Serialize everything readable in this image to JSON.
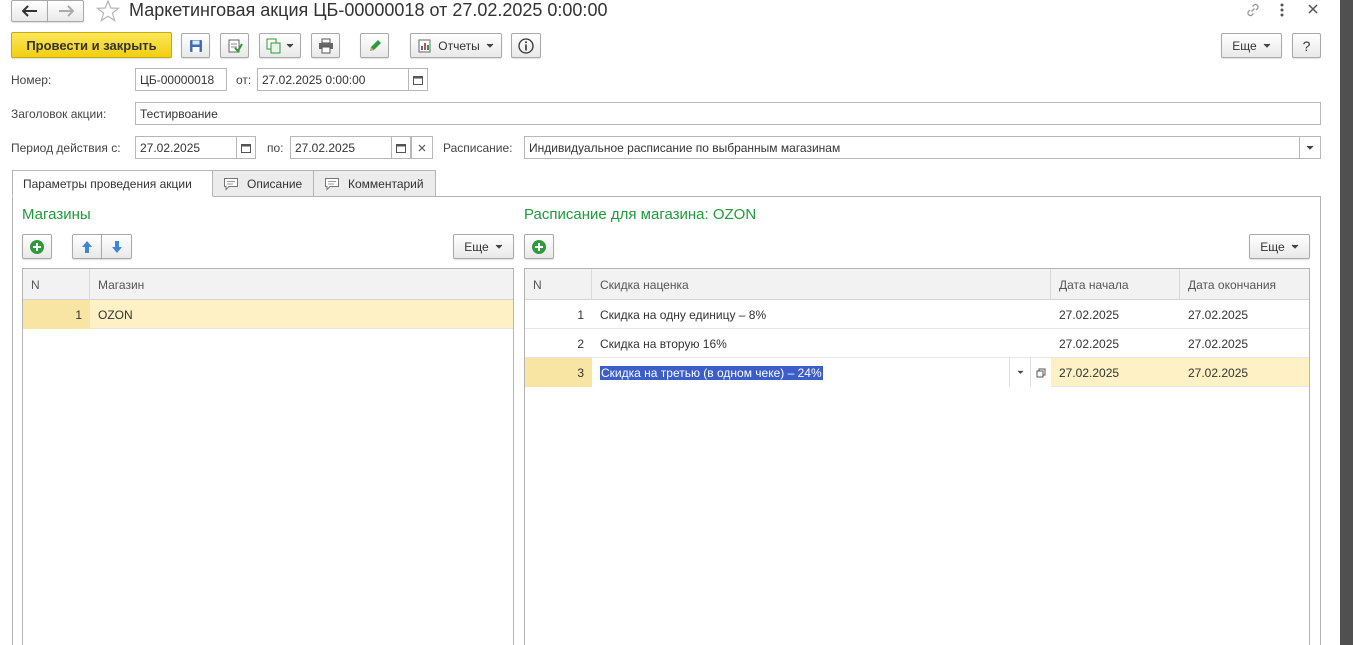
{
  "window": {
    "title": "Маркетинговая акция ЦБ-00000018 от 27.02.2025 0:00:00"
  },
  "toolbar": {
    "post_close": "Провести и закрыть",
    "reports": "Отчеты",
    "more": "Еще",
    "help": "?"
  },
  "form": {
    "number_label": "Номер:",
    "number_value": "ЦБ-00000018",
    "date_label": "от:",
    "date_value": "27.02.2025  0:00:00",
    "header_label": "Заголовок акции:",
    "header_value": "Тестирвоание",
    "period_label": "Период действия с:",
    "period_from": "27.02.2025",
    "period_to_label": "по:",
    "period_to": "27.02.2025",
    "schedule_label": "Расписание:",
    "schedule_value": "Индивидуальное расписание по выбранным магазинам"
  },
  "tabs": [
    {
      "label": "Параметры проведения акции"
    },
    {
      "label": "Описание"
    },
    {
      "label": "Комментарий"
    }
  ],
  "stores": {
    "title": "Магазины",
    "more": "Еще",
    "columns": [
      "N",
      "Магазин"
    ],
    "rows": [
      {
        "n": "1",
        "name": "OZON"
      }
    ]
  },
  "schedule": {
    "title": "Расписание для магазина: OZON",
    "more": "Еще",
    "columns": [
      "N",
      "Скидка наценка",
      "Дата начала",
      "Дата окончания"
    ],
    "rows": [
      {
        "n": "1",
        "discount": "Скидка на одну единицу – 8%",
        "start": "27.02.2025",
        "end": "27.02.2025"
      },
      {
        "n": "2",
        "discount": "Скидка  на вторую 16%",
        "start": "27.02.2025",
        "end": "27.02.2025"
      },
      {
        "n": "3",
        "discount": "Скидка  на третью (в одном чеке) – 24%",
        "start": "27.02.2025",
        "end": "27.02.2025"
      }
    ]
  },
  "colors": {
    "accent_yellow": "#f2cf11",
    "section_green": "#1f9a3c",
    "selected_row": "#fdf1c5",
    "selection_blue": "#3b5ec9"
  }
}
